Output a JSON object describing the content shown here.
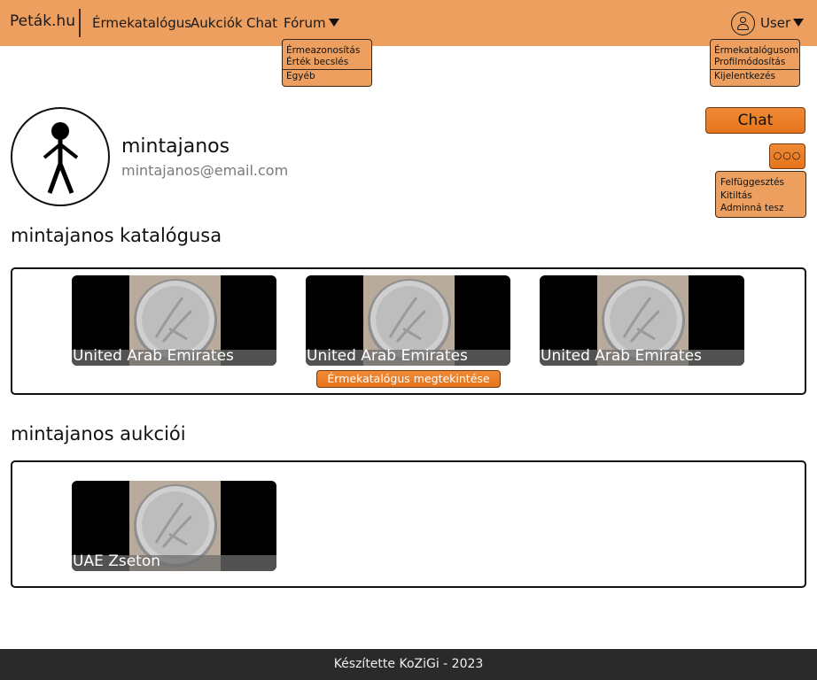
{
  "nav": {
    "brand": "Peták.hu",
    "links": [
      "Érmekatalógus",
      "Aukciók",
      "Chat",
      "Fórum"
    ],
    "user_label": "User"
  },
  "forum_menu": {
    "items": [
      "Érmeazonosítás",
      "Érték becslés",
      "Egyéb"
    ]
  },
  "user_menu": {
    "items": [
      "Érmekatalógusom",
      "Profilmódosítás",
      "Kijelentkezés"
    ]
  },
  "profile": {
    "name": "mintajanos",
    "email": "mintajanos@email.com",
    "chat_button": "Chat",
    "more_button": "○○○",
    "admin_menu": [
      "Felfüggesztés",
      "Kitiltás",
      "Adminná tesz"
    ]
  },
  "catalog": {
    "title": "mintajanos katalógusa",
    "cards": [
      {
        "label": "United Arab Emirates"
      },
      {
        "label": "United Arab Emirates"
      },
      {
        "label": "United Arab Emirates"
      }
    ],
    "view_button": "Érmekatalógus megtekintése"
  },
  "auctions": {
    "title": "mintajanos aukciói",
    "cards": [
      {
        "label": "UAE Zseton"
      }
    ]
  },
  "footer": {
    "text": "Készítette KoZiGi - 2023"
  },
  "colors": {
    "navbar": "#ec9f5f",
    "accent_button": "#e6751c",
    "footer": "#2a2a2a"
  }
}
